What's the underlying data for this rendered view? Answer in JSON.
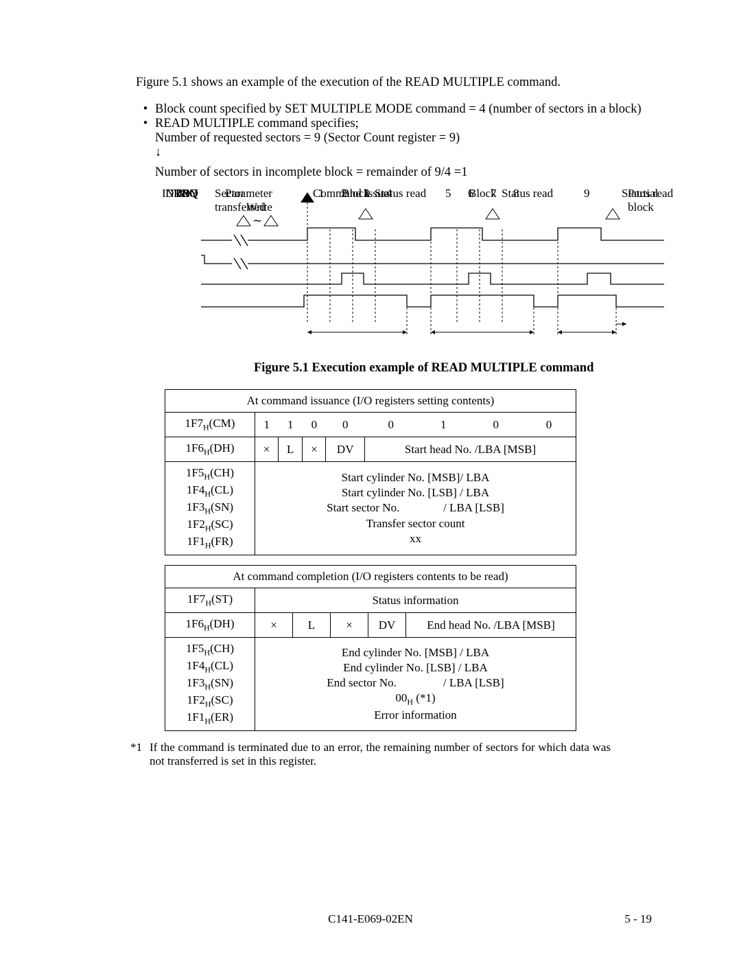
{
  "intro": "Figure 5.1 shows an example of the execution of the READ MULTIPLE command.",
  "bullets": {
    "b1": "Block count specified by SET MULTIPLE MODE command = 4 (number of sectors in a block)",
    "b2": "READ MULTIPLE command specifies;",
    "b2a": "Number of requested sectors = 9 (Sector Count register = 9)",
    "arrow": "↓",
    "after": "Number of sectors in incomplete block = remainder of 9/4 =1"
  },
  "timing": {
    "paramWrite": "Parameter\nWrite",
    "cmdIssue": "Command Issue",
    "statusRead": "Status read",
    "bsy": "BSY",
    "drdy": "DRDY",
    "intrq": "INTRQ",
    "drq": "DRQ",
    "sectorTransferred": "Sector\ntransferred",
    "n1": "1",
    "n2": "2",
    "n3": "3",
    "n4": "4",
    "n5": "5",
    "n6": "6",
    "n7": "7",
    "n8": "8",
    "n9": "9",
    "block": "Block",
    "partialBlock": "Partial\nblock"
  },
  "figCaption": "Figure 5.1    Execution example of READ MULTIPLE command",
  "table1": {
    "title": "At command issuance (I/O registers setting contents)",
    "r1reg": "1F7",
    "r1suf": "(CM)",
    "r1bits": [
      "1",
      "1",
      "0",
      "0",
      "0",
      "1",
      "0",
      "0"
    ],
    "r2reg": "1F6",
    "r2suf": "(DH)",
    "r2c1": "×",
    "r2c2": "L",
    "r2c3": "×",
    "r2c4": "DV",
    "r2c5": "Start head No. /LBA [MSB]",
    "r3reg": "1F5",
    "r3suf": "(CH)",
    "r3v": "Start cylinder No. [MSB]/ LBA",
    "r4reg": "1F4",
    "r4suf": "(CL)",
    "r4v": "Start cylinder No. [LSB] / LBA",
    "r5reg": "1F3",
    "r5suf": "(SN)",
    "r5v": "Start sector No.               / LBA [LSB]",
    "r6reg": "1F2",
    "r6suf": "(SC)",
    "r6v": "Transfer sector count",
    "r7reg": "1F1",
    "r7suf": "(FR)",
    "r7v": "xx"
  },
  "table2": {
    "title": "At command completion (I/O registers contents to be read)",
    "r1reg": "1F7",
    "r1suf": "(ST)",
    "r1v": "Status information",
    "r2reg": "1F6",
    "r2suf": "(DH)",
    "r2c1": "×",
    "r2c2": "L",
    "r2c3": "×",
    "r2c4": "DV",
    "r2c5": "End head No. /LBA [MSB]",
    "r3reg": "1F5",
    "r3suf": "(CH)",
    "r3v": "End cylinder No. [MSB] / LBA",
    "r4reg": "1F4",
    "r4suf": "(CL)",
    "r4v": "End cylinder No. [LSB]  / LBA",
    "r5reg": "1F3",
    "r5suf": "(SN)",
    "r5v": "End sector No.                / LBA [LSB]",
    "r6reg": "1F2",
    "r6suf": "(SC)",
    "r6vPre": "00",
    "r6vPost": " (*1)",
    "r7reg": "1F1",
    "r7suf": "(ER)",
    "r7v": "Error information"
  },
  "footnote": {
    "mark": "*1",
    "text": "If the command is terminated due to an error, the remaining number of sectors for which data was not transferred is set in this register."
  },
  "footer": {
    "doc": "C141-E069-02EN",
    "page": "5 - 19"
  },
  "H": "H"
}
